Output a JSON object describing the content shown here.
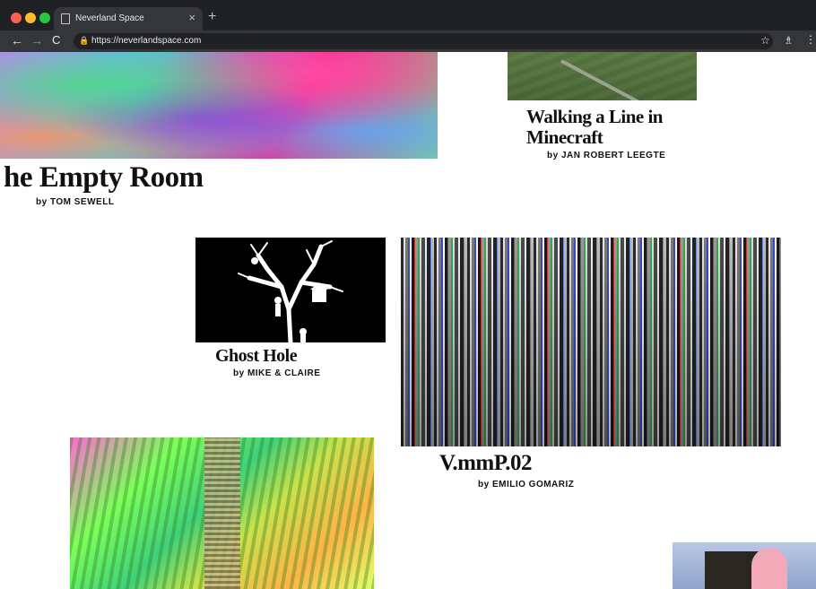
{
  "browser": {
    "tab_title": "Neverland Space",
    "tab_close": "×",
    "new_tab": "+",
    "url": "https://neverlandspace.com",
    "back": "←",
    "forward": "→",
    "reload": "C",
    "lock": "🔒",
    "star": "☆",
    "extension": "♗",
    "menu": "⋮"
  },
  "works": [
    {
      "title": "he Empty Room",
      "byline": "by TOM SEWELL"
    },
    {
      "title": "Walking a Line in",
      "title_line2": "Minecraft",
      "byline": "by JAN ROBERT LEEGTE"
    },
    {
      "title": "Ghost Hole",
      "byline": "by MIKE & CLAIRE"
    },
    {
      "title": "V.mmP.02",
      "byline": "by EMILIO GOMARIZ"
    }
  ],
  "colors": {
    "chrome_dark": "#202124",
    "chrome_toolbar": "#35363a",
    "text": "#111111"
  }
}
